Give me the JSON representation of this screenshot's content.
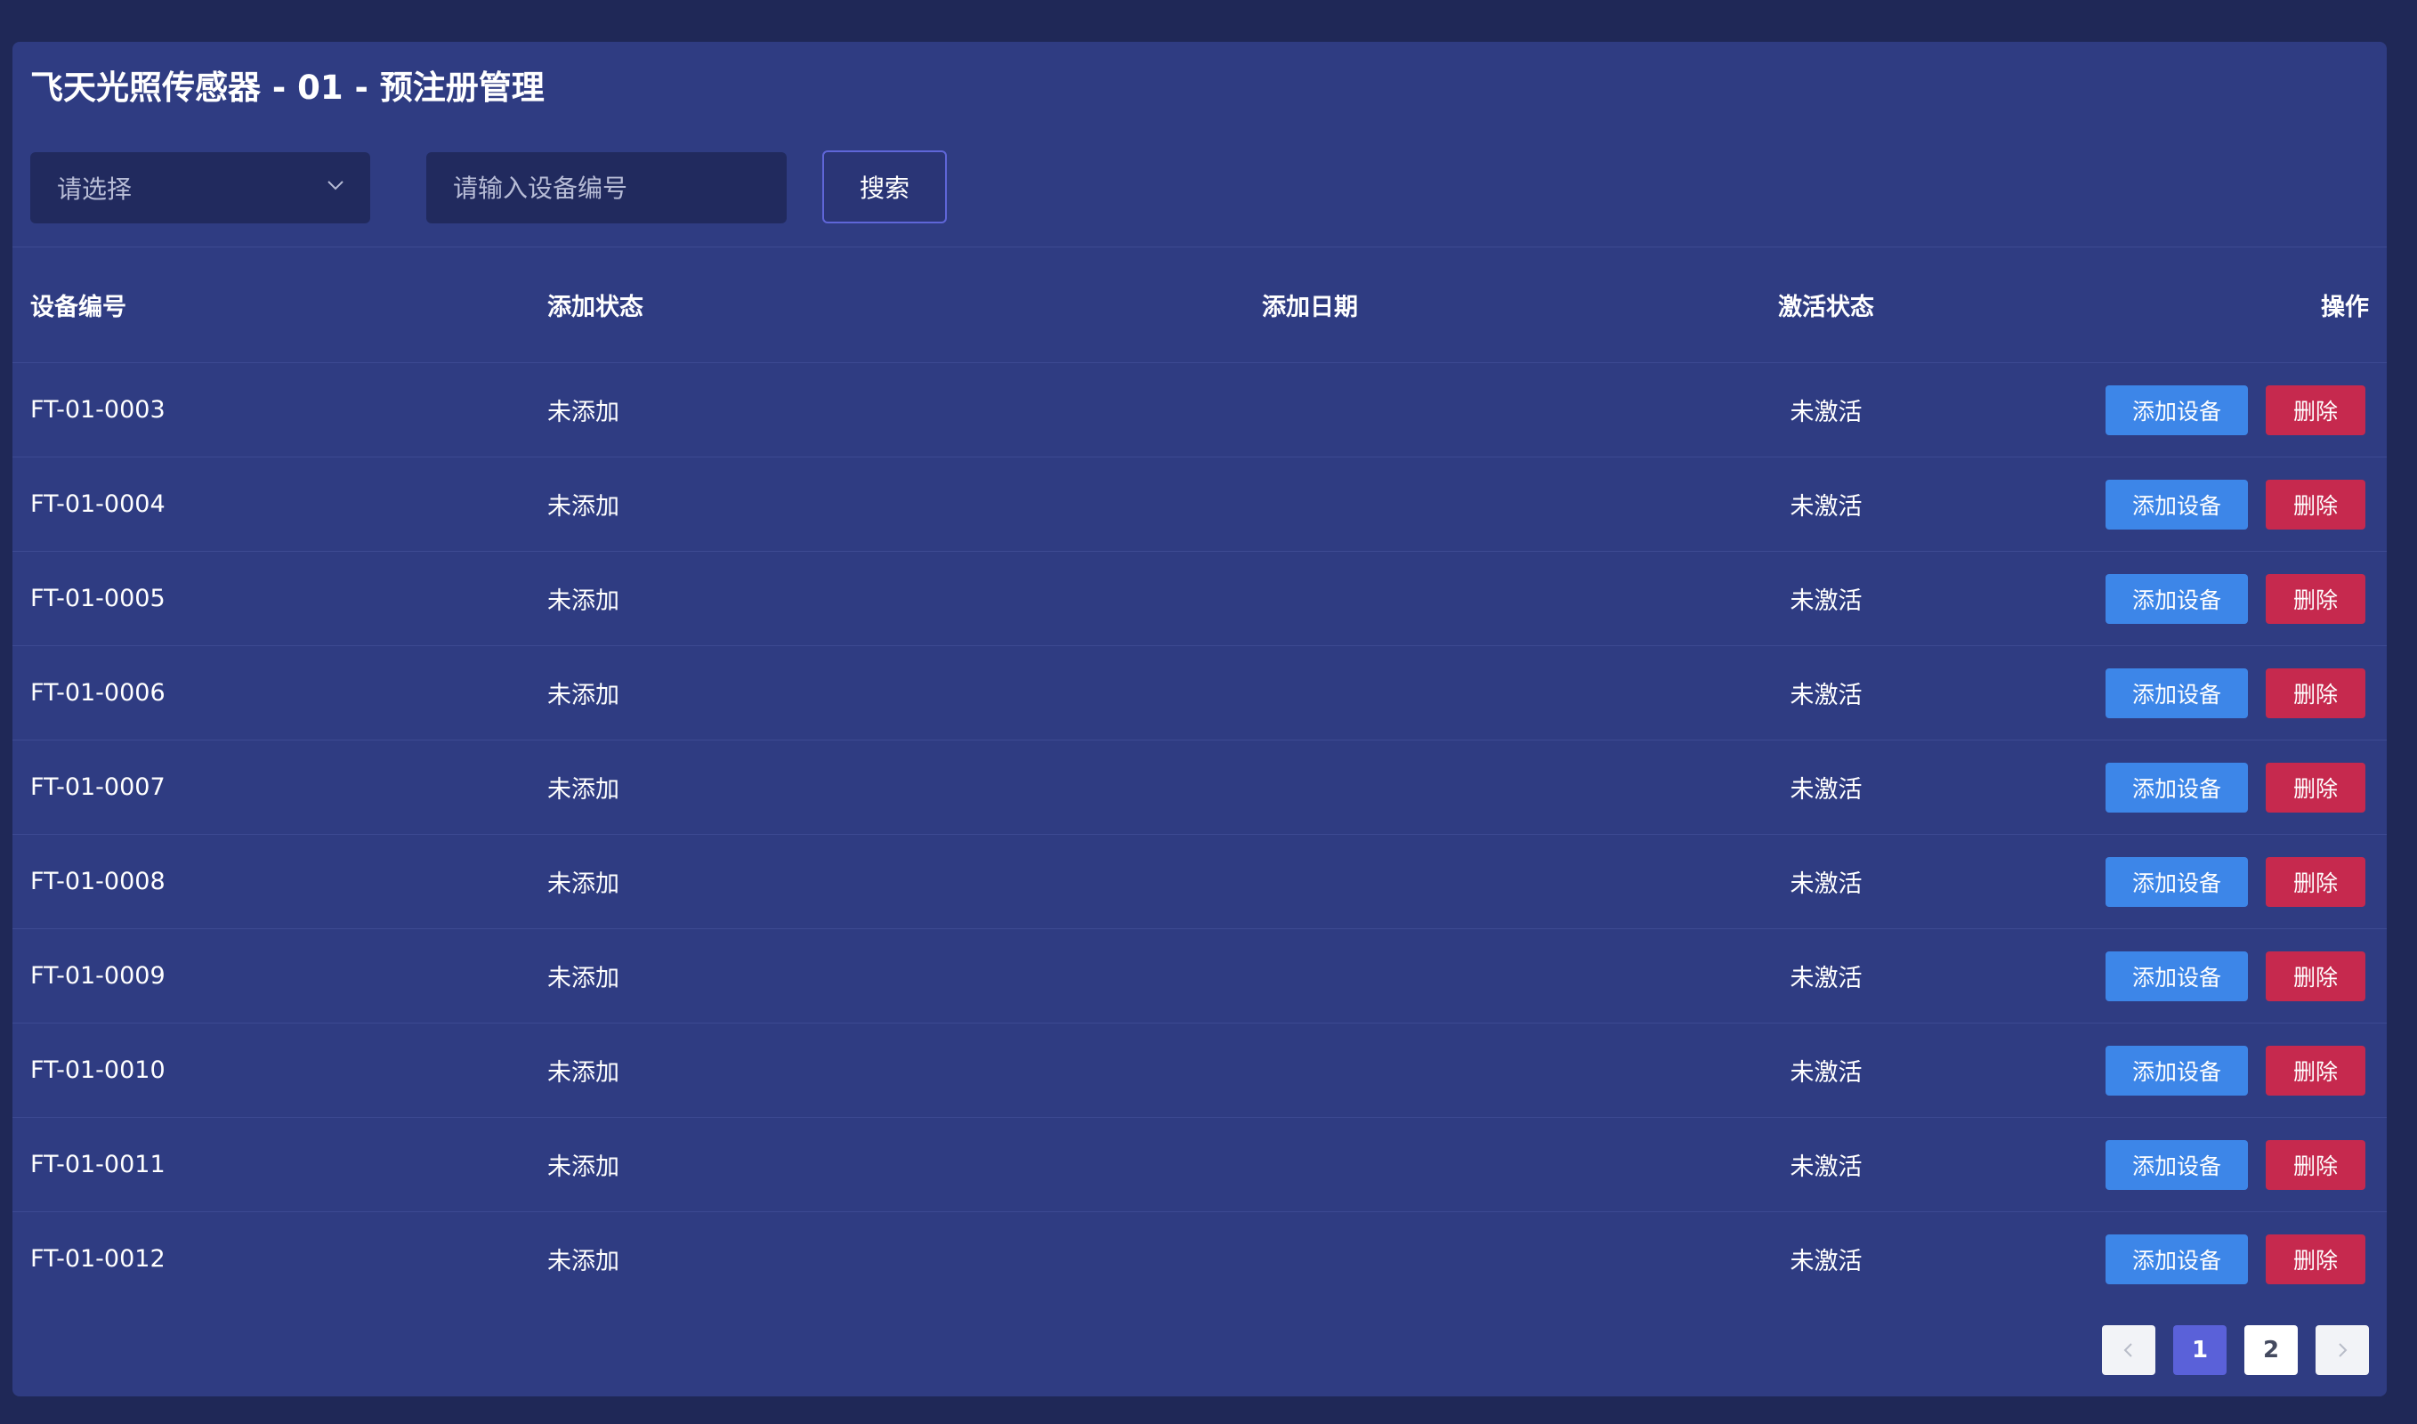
{
  "page": {
    "title": "飞天光照传感器 - 01 - 预注册管理"
  },
  "filters": {
    "select_placeholder": "请选择",
    "search_placeholder": "请输入设备编号",
    "search_button": "搜索"
  },
  "table": {
    "headers": {
      "device_id": "设备编号",
      "add_status": "添加状态",
      "add_date": "添加日期",
      "activation_status": "激活状态",
      "operations": "操作"
    },
    "rows": [
      {
        "device_id": "FT-01-0003",
        "add_status": "未添加",
        "add_date": "",
        "activation_status": "未激活",
        "add_button": "添加设备",
        "delete_button": "删除"
      },
      {
        "device_id": "FT-01-0004",
        "add_status": "未添加",
        "add_date": "",
        "activation_status": "未激活",
        "add_button": "添加设备",
        "delete_button": "删除"
      },
      {
        "device_id": "FT-01-0005",
        "add_status": "未添加",
        "add_date": "",
        "activation_status": "未激活",
        "add_button": "添加设备",
        "delete_button": "删除"
      },
      {
        "device_id": "FT-01-0006",
        "add_status": "未添加",
        "add_date": "",
        "activation_status": "未激活",
        "add_button": "添加设备",
        "delete_button": "删除"
      },
      {
        "device_id": "FT-01-0007",
        "add_status": "未添加",
        "add_date": "",
        "activation_status": "未激活",
        "add_button": "添加设备",
        "delete_button": "删除"
      },
      {
        "device_id": "FT-01-0008",
        "add_status": "未添加",
        "add_date": "",
        "activation_status": "未激活",
        "add_button": "添加设备",
        "delete_button": "删除"
      },
      {
        "device_id": "FT-01-0009",
        "add_status": "未添加",
        "add_date": "",
        "activation_status": "未激活",
        "add_button": "添加设备",
        "delete_button": "删除"
      },
      {
        "device_id": "FT-01-0010",
        "add_status": "未添加",
        "add_date": "",
        "activation_status": "未激活",
        "add_button": "添加设备",
        "delete_button": "删除"
      },
      {
        "device_id": "FT-01-0011",
        "add_status": "未添加",
        "add_date": "",
        "activation_status": "未激活",
        "add_button": "添加设备",
        "delete_button": "删除"
      },
      {
        "device_id": "FT-01-0012",
        "add_status": "未添加",
        "add_date": "",
        "activation_status": "未激活",
        "add_button": "添加设备",
        "delete_button": "删除"
      }
    ]
  },
  "pagination": {
    "pages": [
      "1",
      "2"
    ],
    "current": "1"
  },
  "colors": {
    "background": "#1f2857",
    "panel": "#2f3c82",
    "add_button": "#3d86e8",
    "delete_button": "#c6294e",
    "active_page": "#5a61d9"
  }
}
